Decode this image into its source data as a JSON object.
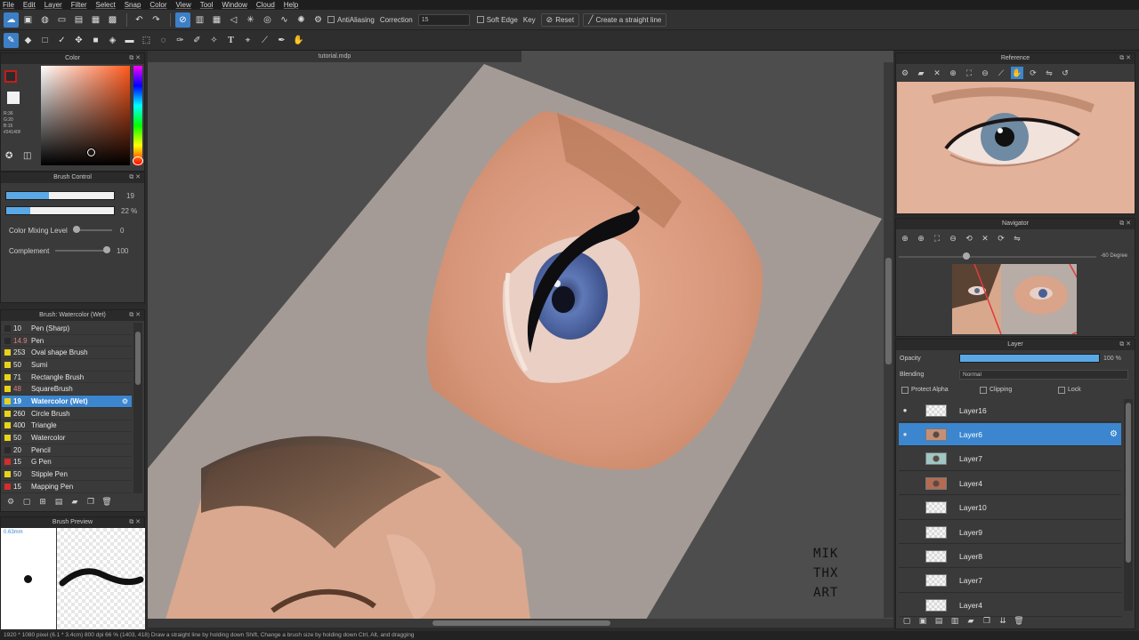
{
  "menu": [
    "File",
    "Edit",
    "Layer",
    "Filter",
    "Select",
    "Snap",
    "Color",
    "View",
    "Tool",
    "Window",
    "Cloud",
    "Help"
  ],
  "toolbar": {
    "antialiasing_label": "AntiAliasing",
    "correction_label": "Correction",
    "correction_value": "15",
    "soft_edge_label": "Soft Edge",
    "key_label": "Key",
    "reset_label": "Reset",
    "straight_line_label": "Create a straight line"
  },
  "canvas": {
    "tab_title": "tutorial.mdp"
  },
  "color_panel": {
    "title": "Color",
    "values": [
      "R:36",
      "G:20",
      "B:15",
      "#24140F"
    ],
    "accent": "#c81b1b"
  },
  "brush_control": {
    "title": "Brush Control",
    "size_value": "19",
    "size_fraction": 0.4,
    "opacity_value": "22 %",
    "opacity_fraction": 0.22,
    "mixing_label": "Color Mixing Level",
    "mixing_value": "0",
    "complement_label": "Complement",
    "complement_value": "100"
  },
  "brush_list": {
    "title": "Brush: Watercolor (Wet)",
    "items": [
      {
        "size": "10",
        "name": "Pen (Sharp)",
        "color": "#2a2a2a"
      },
      {
        "size": "14.9",
        "name": "Pen",
        "color": "#2a2a2a",
        "size_color": "#e08080"
      },
      {
        "size": "253",
        "name": "Oval shape Brush",
        "color": "#e8d21a"
      },
      {
        "size": "50",
        "name": "Sumi",
        "color": "#e8d21a"
      },
      {
        "size": "71",
        "name": "Rectangle Brush",
        "color": "#e8d21a"
      },
      {
        "size": "48",
        "name": "SquareBrush",
        "color": "#e8d21a",
        "size_color": "#e08080"
      },
      {
        "size": "19",
        "name": "Watercolor (Wet)",
        "color": "#e8d21a",
        "selected": true
      },
      {
        "size": "260",
        "name": "Circle Brush",
        "color": "#e8d21a"
      },
      {
        "size": "400",
        "name": "Triangle",
        "color": "#e8d21a"
      },
      {
        "size": "50",
        "name": "Watercolor",
        "color": "#e8d21a"
      },
      {
        "size": "20",
        "name": "Pencil",
        "color": "#2a2a2a"
      },
      {
        "size": "15",
        "name": "G Pen",
        "color": "#d62c2c"
      },
      {
        "size": "50",
        "name": "Stipple Pen",
        "color": "#e8d21a"
      },
      {
        "size": "15",
        "name": "Mapping Pen",
        "color": "#d62c2c"
      }
    ]
  },
  "brush_preview": {
    "title": "Brush Preview",
    "size": "0.63mm"
  },
  "reference": {
    "title": "Reference"
  },
  "navigator": {
    "title": "Navigator",
    "angle": "-60 Degree"
  },
  "layer_panel": {
    "title": "Layer",
    "opacity_label": "Opacity",
    "opacity_value": "100 %",
    "blending_label": "Blending",
    "blending_value": "Normal",
    "protect_alpha": "Protect Alpha",
    "clipping": "Clipping",
    "lock": "Lock",
    "layers": [
      {
        "name": "Layer16",
        "visible": true
      },
      {
        "name": "Layer6",
        "visible": true,
        "selected": true
      },
      {
        "name": "Layer7",
        "visible": false
      },
      {
        "name": "Layer4",
        "visible": false
      },
      {
        "name": "Layer10",
        "visible": false
      },
      {
        "name": "Layer9",
        "visible": false
      },
      {
        "name": "Layer8",
        "visible": false
      },
      {
        "name": "Layer7",
        "visible": false
      },
      {
        "name": "Layer4",
        "visible": false
      }
    ]
  },
  "watermark": {
    "line1": "MIK",
    "line2": "THX",
    "line3": "ART"
  },
  "status": {
    "text": "1920 * 1080 pixel   (6.1 * 3.4cm)   800 dpi   66 %   (1403, 418)   Draw a straight line by holding down Shift, Change a brush size by holding down Ctrl, Alt, and dragging"
  }
}
